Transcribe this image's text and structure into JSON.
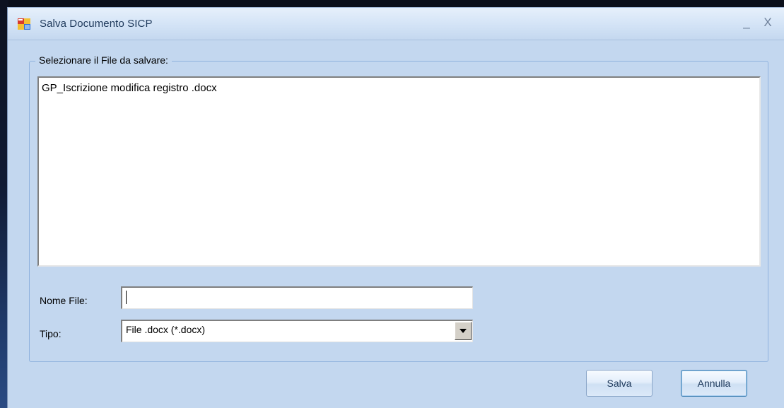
{
  "window": {
    "title": "Salva Documento SICP",
    "minimize_glyph": "_",
    "close_glyph": "X"
  },
  "file_group": {
    "legend": "Selezionare il File da salvare:",
    "files": [
      "GP_Iscrizione modifica registro .docx"
    ]
  },
  "form": {
    "nome_file_label": "Nome File:",
    "nome_file_value": "",
    "tipo_label": "Tipo:",
    "tipo_selected": "File .docx (*.docx)"
  },
  "buttons": {
    "save_label": "Salva",
    "cancel_label": "Annulla"
  },
  "colors": {
    "window_bg": "#c3d7ef",
    "title_text": "#1e395b",
    "group_border": "#8fb2de"
  },
  "icons": {
    "app": "window-app-icon",
    "dropdown": "chevron-down-icon"
  }
}
